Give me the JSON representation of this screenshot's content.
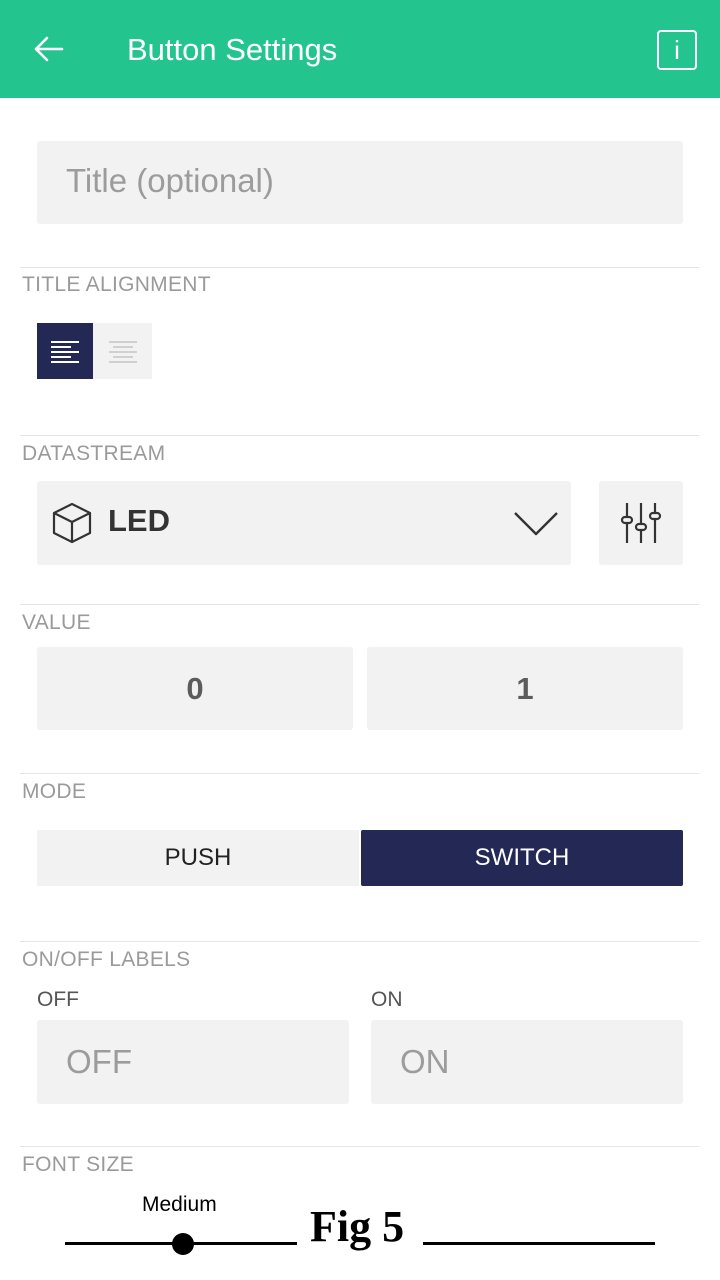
{
  "app_bar": {
    "title": "Button Settings",
    "back_icon": "arrow-left-icon",
    "info_icon": "info-icon",
    "info_glyph": "i",
    "color": "#23c48e"
  },
  "title_field": {
    "placeholder": "Title (optional)"
  },
  "title_alignment": {
    "label": "TITLE ALIGNMENT",
    "options": [
      "left",
      "center"
    ],
    "selected": "left"
  },
  "datastream": {
    "label": "DATASTREAM",
    "selected": "LED",
    "icon": "cube-icon",
    "dropdown_icon": "chevron-down-icon",
    "settings_icon": "sliders-icon"
  },
  "value": {
    "label": "VALUE",
    "min": "0",
    "max": "1"
  },
  "mode": {
    "label": "MODE",
    "options": [
      "PUSH",
      "SWITCH"
    ],
    "selected": "SWITCH",
    "active_color": "#242855"
  },
  "on_off_labels": {
    "label": "ON/OFF LABELS",
    "off_caption": "OFF",
    "on_caption": "ON",
    "off_placeholder": "OFF",
    "on_placeholder": "ON"
  },
  "font_size": {
    "label": "FONT SIZE",
    "value": "Medium"
  },
  "figure_caption": "Fig 5"
}
